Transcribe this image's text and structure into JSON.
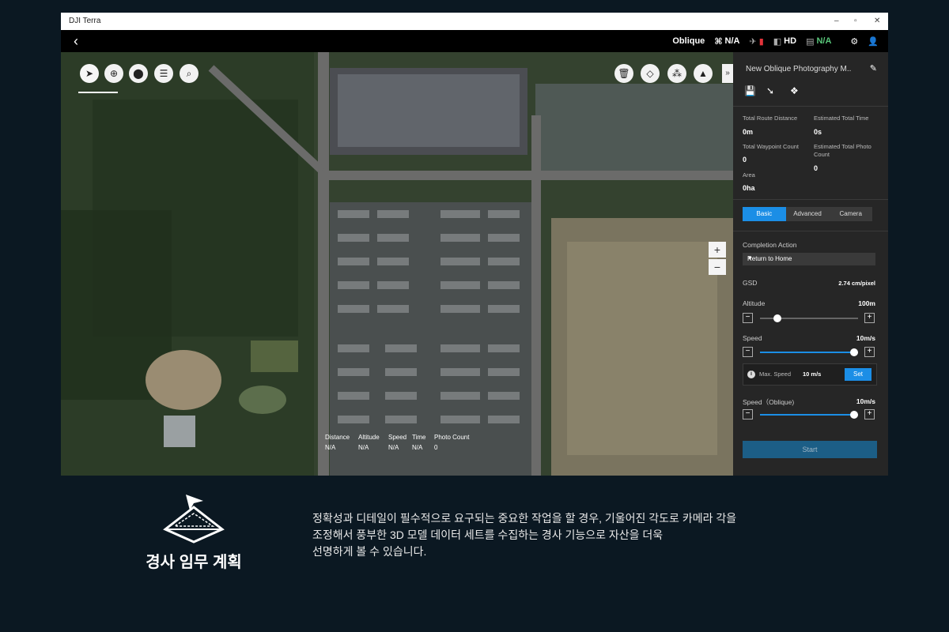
{
  "window": {
    "title": "DJI Terra"
  },
  "topbar": {
    "mode": "Oblique",
    "status_1": "N/A",
    "status_hd": "HD",
    "status_last": "N/A"
  },
  "map": {
    "stats": {
      "headers": [
        "Distance",
        "Altitude",
        "Speed",
        "Time",
        "Photo Count"
      ],
      "values": [
        "N/A",
        "N/A",
        "N/A",
        "N/A",
        "0"
      ]
    },
    "zoom_in": "+",
    "zoom_out": "−"
  },
  "panel": {
    "title": "New Oblique Photography M..",
    "total_route_distance": {
      "label": "Total Route Distance",
      "value": "0m"
    },
    "estimated_total_time": {
      "label": "Estimated Total Time",
      "value": "0s"
    },
    "total_waypoint_count": {
      "label": "Total Waypoint Count",
      "value": "0"
    },
    "estimated_total_photo_count": {
      "label": "Estimated Total Photo Count",
      "value": "0"
    },
    "area": {
      "label": "Area",
      "value": "0ha"
    },
    "tabs": [
      "Basic",
      "Advanced",
      "Camera"
    ],
    "completion_action": {
      "label": "Completion Action",
      "value": "Return to Home"
    },
    "gsd": {
      "label": "GSD",
      "value": "2.74 cm/pixel"
    },
    "altitude": {
      "label": "Altitude",
      "value": "100m",
      "fraction": 0.18
    },
    "speed": {
      "label": "Speed",
      "value": "10m/s",
      "fraction": 0.96
    },
    "max_speed": {
      "label": "Max. Speed",
      "value": "10 m/s",
      "button": "Set"
    },
    "speed_oblique": {
      "label": "Speed（Oblique)",
      "value": "10m/s",
      "fraction": 0.96
    },
    "start": "Start"
  },
  "promo": {
    "title": "경사 임무 계획",
    "lines": [
      "정확성과 디테일이 필수적으로 요구되는 중요한 작업을 할 경우, 기울어진 각도로 카메라 각을",
      "조정해서 풍부한 3D 모델 데이터 세트를 수집하는 경사 기능으로 자산을 더욱",
      "선명하게 볼 수 있습니다."
    ]
  },
  "colors": {
    "accent": "#1b8ee6",
    "status_green": "#59c67a",
    "status_red": "#e3333a",
    "page_bg": "#0b1822"
  }
}
